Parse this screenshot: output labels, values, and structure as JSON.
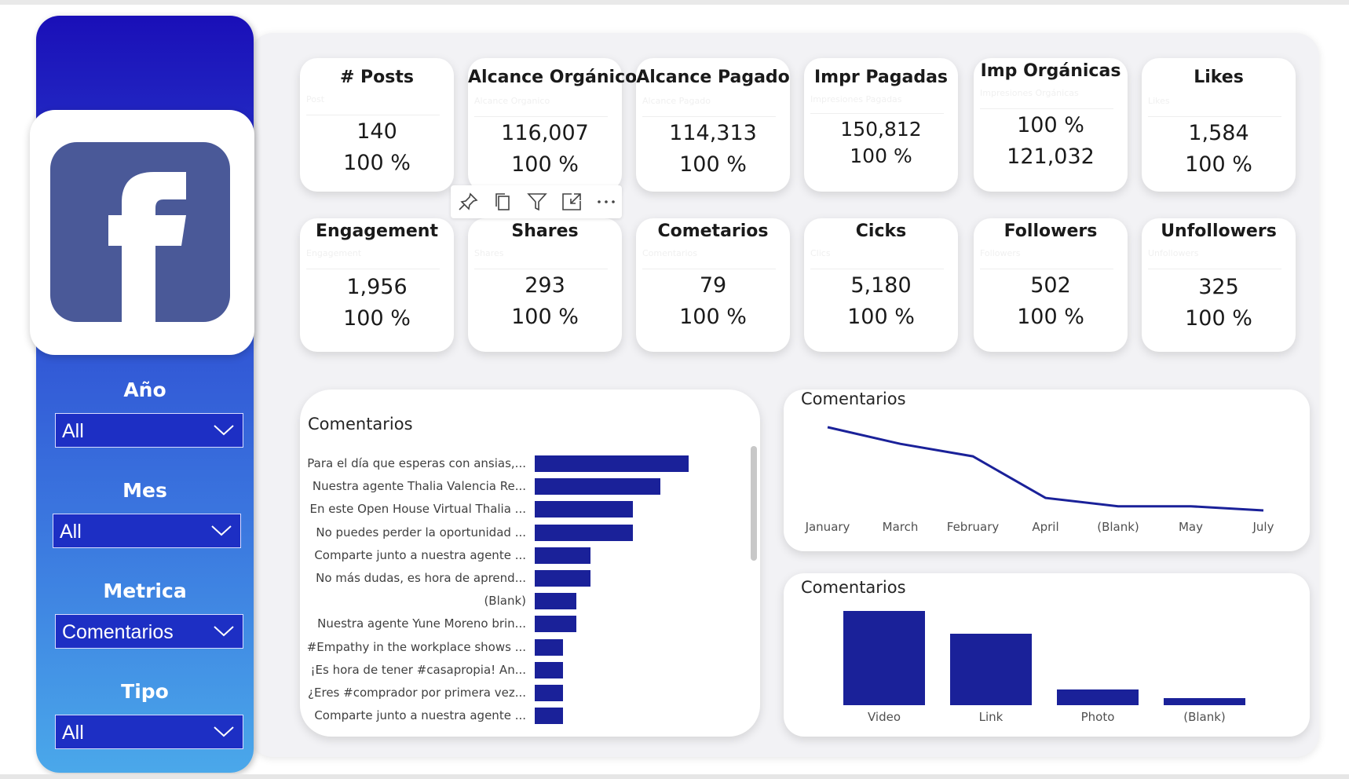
{
  "filters": [
    {
      "label": "Año",
      "value": "All"
    },
    {
      "label": "Mes",
      "value": "All"
    },
    {
      "label": "Metrica",
      "value": "Comentarios"
    },
    {
      "label": "Tipo",
      "value": "All"
    }
  ],
  "kpis": [
    {
      "title": "# Posts",
      "subtitle": "Post",
      "value": "140",
      "percent": "100 %"
    },
    {
      "title": "Alcance Orgánico",
      "subtitle": "Alcance Organico",
      "value": "116,007",
      "percent": "100 %"
    },
    {
      "title": "Alcance Pagado",
      "subtitle": "Alcance Pagado",
      "value": "114,313",
      "percent": "100 %"
    },
    {
      "title": "Impr Pagadas",
      "subtitle": "Impresiones Pagadas",
      "value": "150,812",
      "percent": "100 %"
    },
    {
      "title": "Imp Orgánicas",
      "subtitle": "Impresiones Orgánicas",
      "value": "100 %",
      "percent": "121,032"
    },
    {
      "title": "Likes",
      "subtitle": "Likes",
      "value": "1,584",
      "percent": "100 %"
    },
    {
      "title": "Engagement",
      "subtitle": "Engagement",
      "value": "1,956",
      "percent": "100 %"
    },
    {
      "title": "Shares",
      "subtitle": "Shares",
      "value": "293",
      "percent": "100 %"
    },
    {
      "title": "Cometarios",
      "subtitle": "Comentarios",
      "value": "79",
      "percent": "100 %"
    },
    {
      "title": "Cicks",
      "subtitle": "Clics",
      "value": "5,180",
      "percent": "100 %"
    },
    {
      "title": "Followers",
      "subtitle": "Followers",
      "value": "502",
      "percent": "100 %"
    },
    {
      "title": "Unfollowers",
      "subtitle": "Unfollowers",
      "value": "325",
      "percent": "100 %"
    }
  ],
  "toolbar_icons": [
    "pin-icon",
    "copy-icon",
    "filter-icon",
    "focus-mode-icon",
    "more-options-icon"
  ],
  "colors": {
    "bar": "#1a2199",
    "sidebar_top": "#1a0fb8",
    "sidebar_bottom": "#4aa8ea",
    "fb_blue": "#4a5998"
  },
  "chart_data": [
    {
      "type": "bar",
      "orientation": "horizontal",
      "title": "Comentarios",
      "categories": [
        "Para el día que esperas con ansias,...",
        "Nuestra agente Thalia Valencia Re...",
        "En este Open House Virtual Thalia ...",
        "No puedes perder la oportunidad ...",
        "Comparte junto a nuestra agente ...",
        "No más dudas, es hora de aprend...",
        "(Blank)",
        "Nuestra agente Yune Moreno brin...",
        "#Empathy in the workplace shows ...",
        "¡Es hora de tener #casapropia! An...",
        "¿Eres #comprador por primera vez...",
        "Comparte junto a nuestra agente ..."
      ],
      "values": [
        11,
        9,
        7,
        7,
        4,
        4,
        3,
        3,
        2,
        2,
        2,
        2
      ]
    },
    {
      "type": "line",
      "title": "Comentarios",
      "categories": [
        "January",
        "March",
        "February",
        "April",
        "(Blank)",
        "May",
        "July"
      ],
      "values": [
        20,
        16,
        13,
        3,
        1,
        1,
        0
      ]
    },
    {
      "type": "bar",
      "title": "Comentarios",
      "categories": [
        "Video",
        "Link",
        "Photo",
        "(Blank)"
      ],
      "values": [
        41,
        31,
        7,
        3
      ]
    }
  ]
}
